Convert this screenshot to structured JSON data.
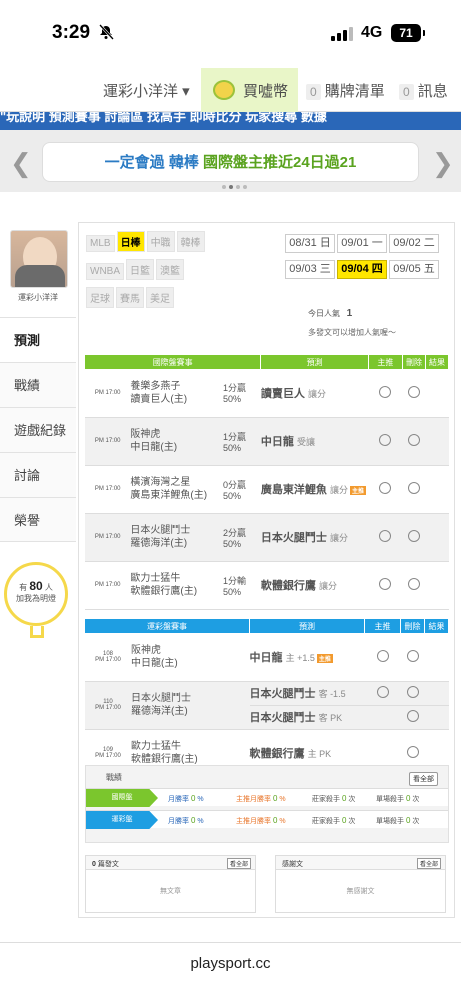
{
  "status": {
    "time": "3:29",
    "network": "4G",
    "battery": "71"
  },
  "nav": {
    "user": "運彩小洋洋 ▾",
    "coin": "買噓幣",
    "cart_count": "0",
    "cart": "購牌清單",
    "msg_count": "0",
    "msg": "訊息"
  },
  "strip": "\"玩說明  預測賽事  討論區  找高手  即時比分  玩家搜尋  數據",
  "banner": {
    "g1": "一定會過",
    "g2": "韓棒",
    "g3": "國際盤主推近24日過21"
  },
  "profile": {
    "name": "運彩小洋洋"
  },
  "menu": [
    "預測",
    "戰績",
    "遊戲紀錄",
    "討論",
    "榮譽"
  ],
  "bulb": {
    "prefix": "有",
    "count": "80",
    "suffix": "人",
    "text": "加我為明燈"
  },
  "leagues": [
    [
      "MLB",
      "日棒",
      "中職",
      "韓棒"
    ],
    [
      "WNBA",
      "日籃",
      "澳籃"
    ],
    [
      "足球",
      "賽馬",
      "美足"
    ]
  ],
  "dates": [
    [
      "08/31 日",
      "09/01 一",
      "09/02 二"
    ],
    [
      "09/03 三",
      "09/04 四",
      "09/05 五"
    ]
  ],
  "pop": {
    "label": "今日人氣",
    "value": "1",
    "note": "多發文可以增加人氣喔～"
  },
  "intl": {
    "headers": [
      "國際盤賽事",
      "預測",
      "主推",
      "刪除",
      "結果"
    ],
    "rows": [
      {
        "time": "PM 17:00",
        "t1": "養樂多燕子",
        "t2": "讀賣巨人(主)",
        "o1": "1分贏",
        "o2": "50%",
        "pick": "讀賣巨人",
        "kind": "讓分",
        "tag": ""
      },
      {
        "time": "PM 17:00",
        "t1": "阪神虎",
        "t2": "中日龍(主)",
        "o1": "1分贏",
        "o2": "50%",
        "pick": "中日龍",
        "kind": "受讓",
        "tag": ""
      },
      {
        "time": "PM 17:00",
        "t1": "橫濱海灣之星",
        "t2": "廣島東洋鯉魚(主)",
        "o1": "0分贏",
        "o2": "50%",
        "pick": "廣島東洋鯉魚",
        "kind": "讓分",
        "tag": "主推"
      },
      {
        "time": "PM 17:00",
        "t1": "日本火腿鬥士",
        "t2": "羅德海洋(主)",
        "o1": "2分贏",
        "o2": "50%",
        "pick": "日本火腿鬥士",
        "kind": "讓分",
        "tag": ""
      },
      {
        "time": "PM 17:00",
        "t1": "歐力士猛牛",
        "t2": "軟體銀行鷹(主)",
        "o1": "1分輸",
        "o2": "50%",
        "pick": "軟體銀行鷹",
        "kind": "讓分",
        "tag": ""
      }
    ]
  },
  "lottery": {
    "headers": [
      "運彩盤賽事",
      "預測",
      "主推",
      "刪除",
      "結果"
    ],
    "rows": [
      {
        "no": "108",
        "time": "PM 17:00",
        "t1": "阪神虎",
        "t2": "中日龍(主)",
        "picks": [
          {
            "pick": "中日龍",
            "kind": "主 +1.5",
            "tag": "主推"
          }
        ]
      },
      {
        "no": "110",
        "time": "PM 17:00",
        "t1": "日本火腿鬥士",
        "t2": "羅德海洋(主)",
        "picks": [
          {
            "pick": "日本火腿鬥士",
            "kind": "客 -1.5",
            "tag": ""
          },
          {
            "pick": "日本火腿鬥士",
            "kind": "客 PK",
            "tag": ""
          }
        ]
      },
      {
        "no": "109",
        "time": "PM 17:00",
        "t1": "歐力士猛牛",
        "t2": "軟體銀行鷹(主)",
        "picks": [
          {
            "pick": "軟體銀行鷹",
            "kind": "主 PK",
            "tag": ""
          }
        ]
      }
    ]
  },
  "record": {
    "title": "戰績",
    "all": "看全部",
    "rows": [
      {
        "label": "國際盤",
        "a": "月勝率",
        "av": "0",
        "b": "主推月勝率",
        "bv": "0",
        "c": "莊家殺手",
        "cv": "0",
        "d": "單場殺手",
        "dv": "0"
      },
      {
        "label": "運彩盤",
        "a": "月勝率",
        "av": "0",
        "b": "主推月勝率",
        "bv": "0",
        "c": "莊家殺手",
        "cv": "0",
        "d": "單場殺手",
        "dv": "0"
      }
    ]
  },
  "posts": {
    "count": "0",
    "label": "篇發文",
    "all": "看全部",
    "empty": "無文章"
  },
  "replies": {
    "label": "感謝文",
    "all": "看全部",
    "empty": "無感謝文"
  },
  "footer": "playsport.cc",
  "colors": {
    "intl": "#7bc62d",
    "lottery": "#1e9ee2",
    "accent": "#ffe600"
  }
}
